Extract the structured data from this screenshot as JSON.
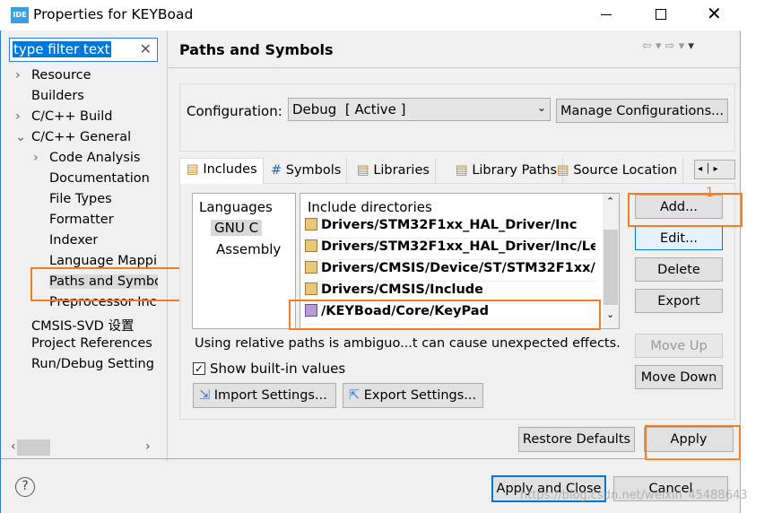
{
  "window": {
    "title": "Properties for KEYBoad",
    "app_icon": "IDE"
  },
  "filter": {
    "value": "type filter text"
  },
  "tree": [
    {
      "label": "Resource",
      "chev": ">"
    },
    {
      "label": "Builders",
      "chev": ""
    },
    {
      "label": "C/C++ Build",
      "chev": ">"
    },
    {
      "label": "C/C++ General",
      "chev": "v"
    },
    {
      "label": "Code Analysis",
      "chev": ">"
    },
    {
      "label": "Documentation",
      "chev": ""
    },
    {
      "label": "File Types",
      "chev": ""
    },
    {
      "label": "Formatter",
      "chev": ""
    },
    {
      "label": "Indexer",
      "chev": ""
    },
    {
      "label": "Language Mappi",
      "chev": ""
    },
    {
      "label": "Paths and Symbo",
      "chev": ""
    },
    {
      "label": "Preprocessor Inc",
      "chev": ""
    },
    {
      "label": "CMSIS-SVD 设置",
      "chev": ""
    },
    {
      "label": "Project References",
      "chev": ""
    },
    {
      "label": "Run/Debug Setting",
      "chev": ""
    }
  ],
  "page": {
    "title": "Paths and Symbols"
  },
  "config": {
    "label": "Configuration:",
    "value": "Debug  [ Active ]",
    "manage": "Manage Configurations..."
  },
  "tabs": [
    "Includes",
    "Symbols",
    "Libraries",
    "Library Paths",
    "Source Location"
  ],
  "languages": {
    "header": "Languages",
    "items": [
      "GNU C",
      "Assembly"
    ]
  },
  "includes": {
    "header": "Include directories",
    "items": [
      "Drivers/STM32F1xx_HAL_Driver/Inc",
      "Drivers/STM32F1xx_HAL_Driver/Inc/Le...",
      "Drivers/CMSIS/Device/ST/STM32F1xx/...",
      "Drivers/CMSIS/Include",
      "/KEYBoad/Core/KeyPad"
    ]
  },
  "side_buttons": {
    "add": "Add...",
    "edit": "Edit...",
    "delete": "Delete",
    "export": "Export",
    "move_up": "Move Up",
    "move_down": "Move Down"
  },
  "annotation": "1",
  "warning": "Using relative paths is ambiguo...t can cause unexpected effects.",
  "show_builtin": {
    "label": "Show built-in values",
    "checked": true
  },
  "import_settings": "Import Settings...",
  "export_settings": "Export Settings...",
  "restore_defaults": "Restore Defaults",
  "apply": "Apply",
  "apply_close": "Apply and Close",
  "cancel": "Cancel",
  "watermark": "https://blog.csdn.net/weixin_45488643",
  "colors": {
    "highlight": "#f57c20",
    "selection": "#0078d7"
  }
}
